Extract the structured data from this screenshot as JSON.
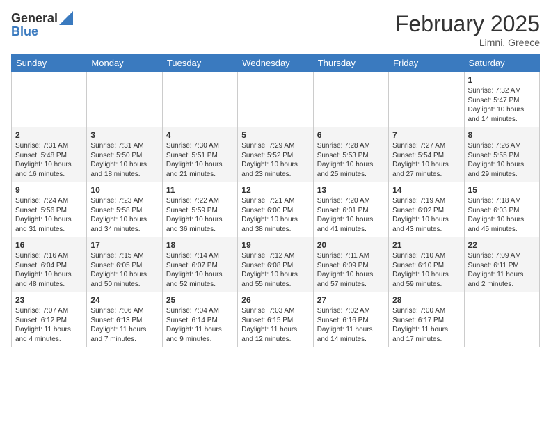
{
  "header": {
    "logo_general": "General",
    "logo_blue": "Blue",
    "month_title": "February 2025",
    "location": "Limni, Greece"
  },
  "days_of_week": [
    "Sunday",
    "Monday",
    "Tuesday",
    "Wednesday",
    "Thursday",
    "Friday",
    "Saturday"
  ],
  "weeks": [
    [
      {
        "day": "",
        "info": ""
      },
      {
        "day": "",
        "info": ""
      },
      {
        "day": "",
        "info": ""
      },
      {
        "day": "",
        "info": ""
      },
      {
        "day": "",
        "info": ""
      },
      {
        "day": "",
        "info": ""
      },
      {
        "day": "1",
        "info": "Sunrise: 7:32 AM\nSunset: 5:47 PM\nDaylight: 10 hours\nand 14 minutes."
      }
    ],
    [
      {
        "day": "2",
        "info": "Sunrise: 7:31 AM\nSunset: 5:48 PM\nDaylight: 10 hours\nand 16 minutes."
      },
      {
        "day": "3",
        "info": "Sunrise: 7:31 AM\nSunset: 5:50 PM\nDaylight: 10 hours\nand 18 minutes."
      },
      {
        "day": "4",
        "info": "Sunrise: 7:30 AM\nSunset: 5:51 PM\nDaylight: 10 hours\nand 21 minutes."
      },
      {
        "day": "5",
        "info": "Sunrise: 7:29 AM\nSunset: 5:52 PM\nDaylight: 10 hours\nand 23 minutes."
      },
      {
        "day": "6",
        "info": "Sunrise: 7:28 AM\nSunset: 5:53 PM\nDaylight: 10 hours\nand 25 minutes."
      },
      {
        "day": "7",
        "info": "Sunrise: 7:27 AM\nSunset: 5:54 PM\nDaylight: 10 hours\nand 27 minutes."
      },
      {
        "day": "8",
        "info": "Sunrise: 7:26 AM\nSunset: 5:55 PM\nDaylight: 10 hours\nand 29 minutes."
      }
    ],
    [
      {
        "day": "9",
        "info": "Sunrise: 7:24 AM\nSunset: 5:56 PM\nDaylight: 10 hours\nand 31 minutes."
      },
      {
        "day": "10",
        "info": "Sunrise: 7:23 AM\nSunset: 5:58 PM\nDaylight: 10 hours\nand 34 minutes."
      },
      {
        "day": "11",
        "info": "Sunrise: 7:22 AM\nSunset: 5:59 PM\nDaylight: 10 hours\nand 36 minutes."
      },
      {
        "day": "12",
        "info": "Sunrise: 7:21 AM\nSunset: 6:00 PM\nDaylight: 10 hours\nand 38 minutes."
      },
      {
        "day": "13",
        "info": "Sunrise: 7:20 AM\nSunset: 6:01 PM\nDaylight: 10 hours\nand 41 minutes."
      },
      {
        "day": "14",
        "info": "Sunrise: 7:19 AM\nSunset: 6:02 PM\nDaylight: 10 hours\nand 43 minutes."
      },
      {
        "day": "15",
        "info": "Sunrise: 7:18 AM\nSunset: 6:03 PM\nDaylight: 10 hours\nand 45 minutes."
      }
    ],
    [
      {
        "day": "16",
        "info": "Sunrise: 7:16 AM\nSunset: 6:04 PM\nDaylight: 10 hours\nand 48 minutes."
      },
      {
        "day": "17",
        "info": "Sunrise: 7:15 AM\nSunset: 6:05 PM\nDaylight: 10 hours\nand 50 minutes."
      },
      {
        "day": "18",
        "info": "Sunrise: 7:14 AM\nSunset: 6:07 PM\nDaylight: 10 hours\nand 52 minutes."
      },
      {
        "day": "19",
        "info": "Sunrise: 7:12 AM\nSunset: 6:08 PM\nDaylight: 10 hours\nand 55 minutes."
      },
      {
        "day": "20",
        "info": "Sunrise: 7:11 AM\nSunset: 6:09 PM\nDaylight: 10 hours\nand 57 minutes."
      },
      {
        "day": "21",
        "info": "Sunrise: 7:10 AM\nSunset: 6:10 PM\nDaylight: 10 hours\nand 59 minutes."
      },
      {
        "day": "22",
        "info": "Sunrise: 7:09 AM\nSunset: 6:11 PM\nDaylight: 11 hours\nand 2 minutes."
      }
    ],
    [
      {
        "day": "23",
        "info": "Sunrise: 7:07 AM\nSunset: 6:12 PM\nDaylight: 11 hours\nand 4 minutes."
      },
      {
        "day": "24",
        "info": "Sunrise: 7:06 AM\nSunset: 6:13 PM\nDaylight: 11 hours\nand 7 minutes."
      },
      {
        "day": "25",
        "info": "Sunrise: 7:04 AM\nSunset: 6:14 PM\nDaylight: 11 hours\nand 9 minutes."
      },
      {
        "day": "26",
        "info": "Sunrise: 7:03 AM\nSunset: 6:15 PM\nDaylight: 11 hours\nand 12 minutes."
      },
      {
        "day": "27",
        "info": "Sunrise: 7:02 AM\nSunset: 6:16 PM\nDaylight: 11 hours\nand 14 minutes."
      },
      {
        "day": "28",
        "info": "Sunrise: 7:00 AM\nSunset: 6:17 PM\nDaylight: 11 hours\nand 17 minutes."
      },
      {
        "day": "",
        "info": ""
      }
    ]
  ]
}
